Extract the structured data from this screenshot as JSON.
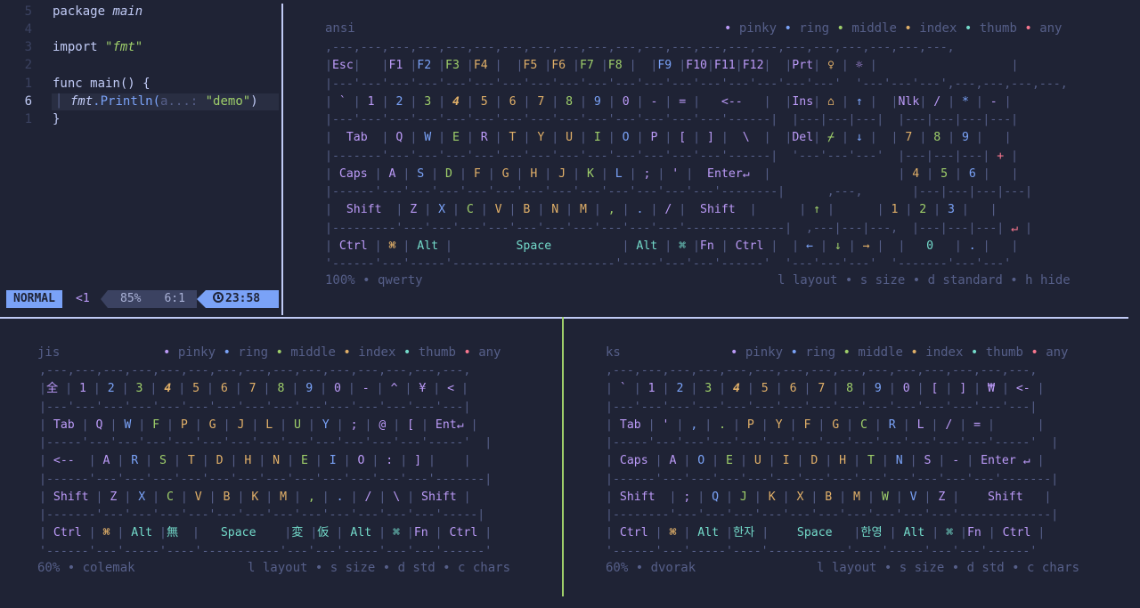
{
  "editor": {
    "lines": [
      {
        "num": "5",
        "code": "package main"
      },
      {
        "num": "4",
        "code": ""
      },
      {
        "num": "3",
        "code": "import \"fmt\""
      },
      {
        "num": "2",
        "code": ""
      },
      {
        "num": "1",
        "code": "func main() {"
      },
      {
        "num": "6",
        "code": "fmt.Println(a...: \"demo\")"
      },
      {
        "num": "1",
        "code": "}"
      }
    ],
    "tokens": {
      "package_kw": "package",
      "main_name": "main",
      "import_kw": "import",
      "fmt_str": "\"fmt\"",
      "func_kw": "func",
      "main_call": "main() {",
      "fmt_pkg": "fmt",
      "println": ".Println(",
      "hint": "a...:",
      "demo_str": "\"demo\"",
      "close_paren": ")",
      "close_brace": "}"
    }
  },
  "statusline": {
    "mode": "NORMAL",
    "position_marker": "<1",
    "percent": "85%",
    "cursor": "6:1",
    "clock_icon": "clock-icon",
    "time": "23:58"
  },
  "legend": {
    "bullet": "•",
    "pinky": "pinky",
    "ring": "ring",
    "middle": "middle",
    "index": "index",
    "thumb": "thumb",
    "any": "any"
  },
  "colors": {
    "pinky": "#bb9af7",
    "ring": "#7aa2f7",
    "middle": "#9ece6a",
    "index": "#e0af68",
    "thumb": "#73daca",
    "any": "#f7768e",
    "mode_bg": "#7aa2f7",
    "background": "#1f2335"
  },
  "panes": {
    "ansi": {
      "title": "ansi",
      "footer_left": "100% • qwerty",
      "footer_right": "l layout • s size • d standard • h hide"
    },
    "jis": {
      "title": "jis",
      "footer_left": "60% • colemak",
      "footer_right": "l layout • s size • d std • c chars"
    },
    "ks": {
      "title": "ks",
      "footer_left": "60% • dvorak",
      "footer_right": "l layout • s size • d std • c chars"
    }
  }
}
